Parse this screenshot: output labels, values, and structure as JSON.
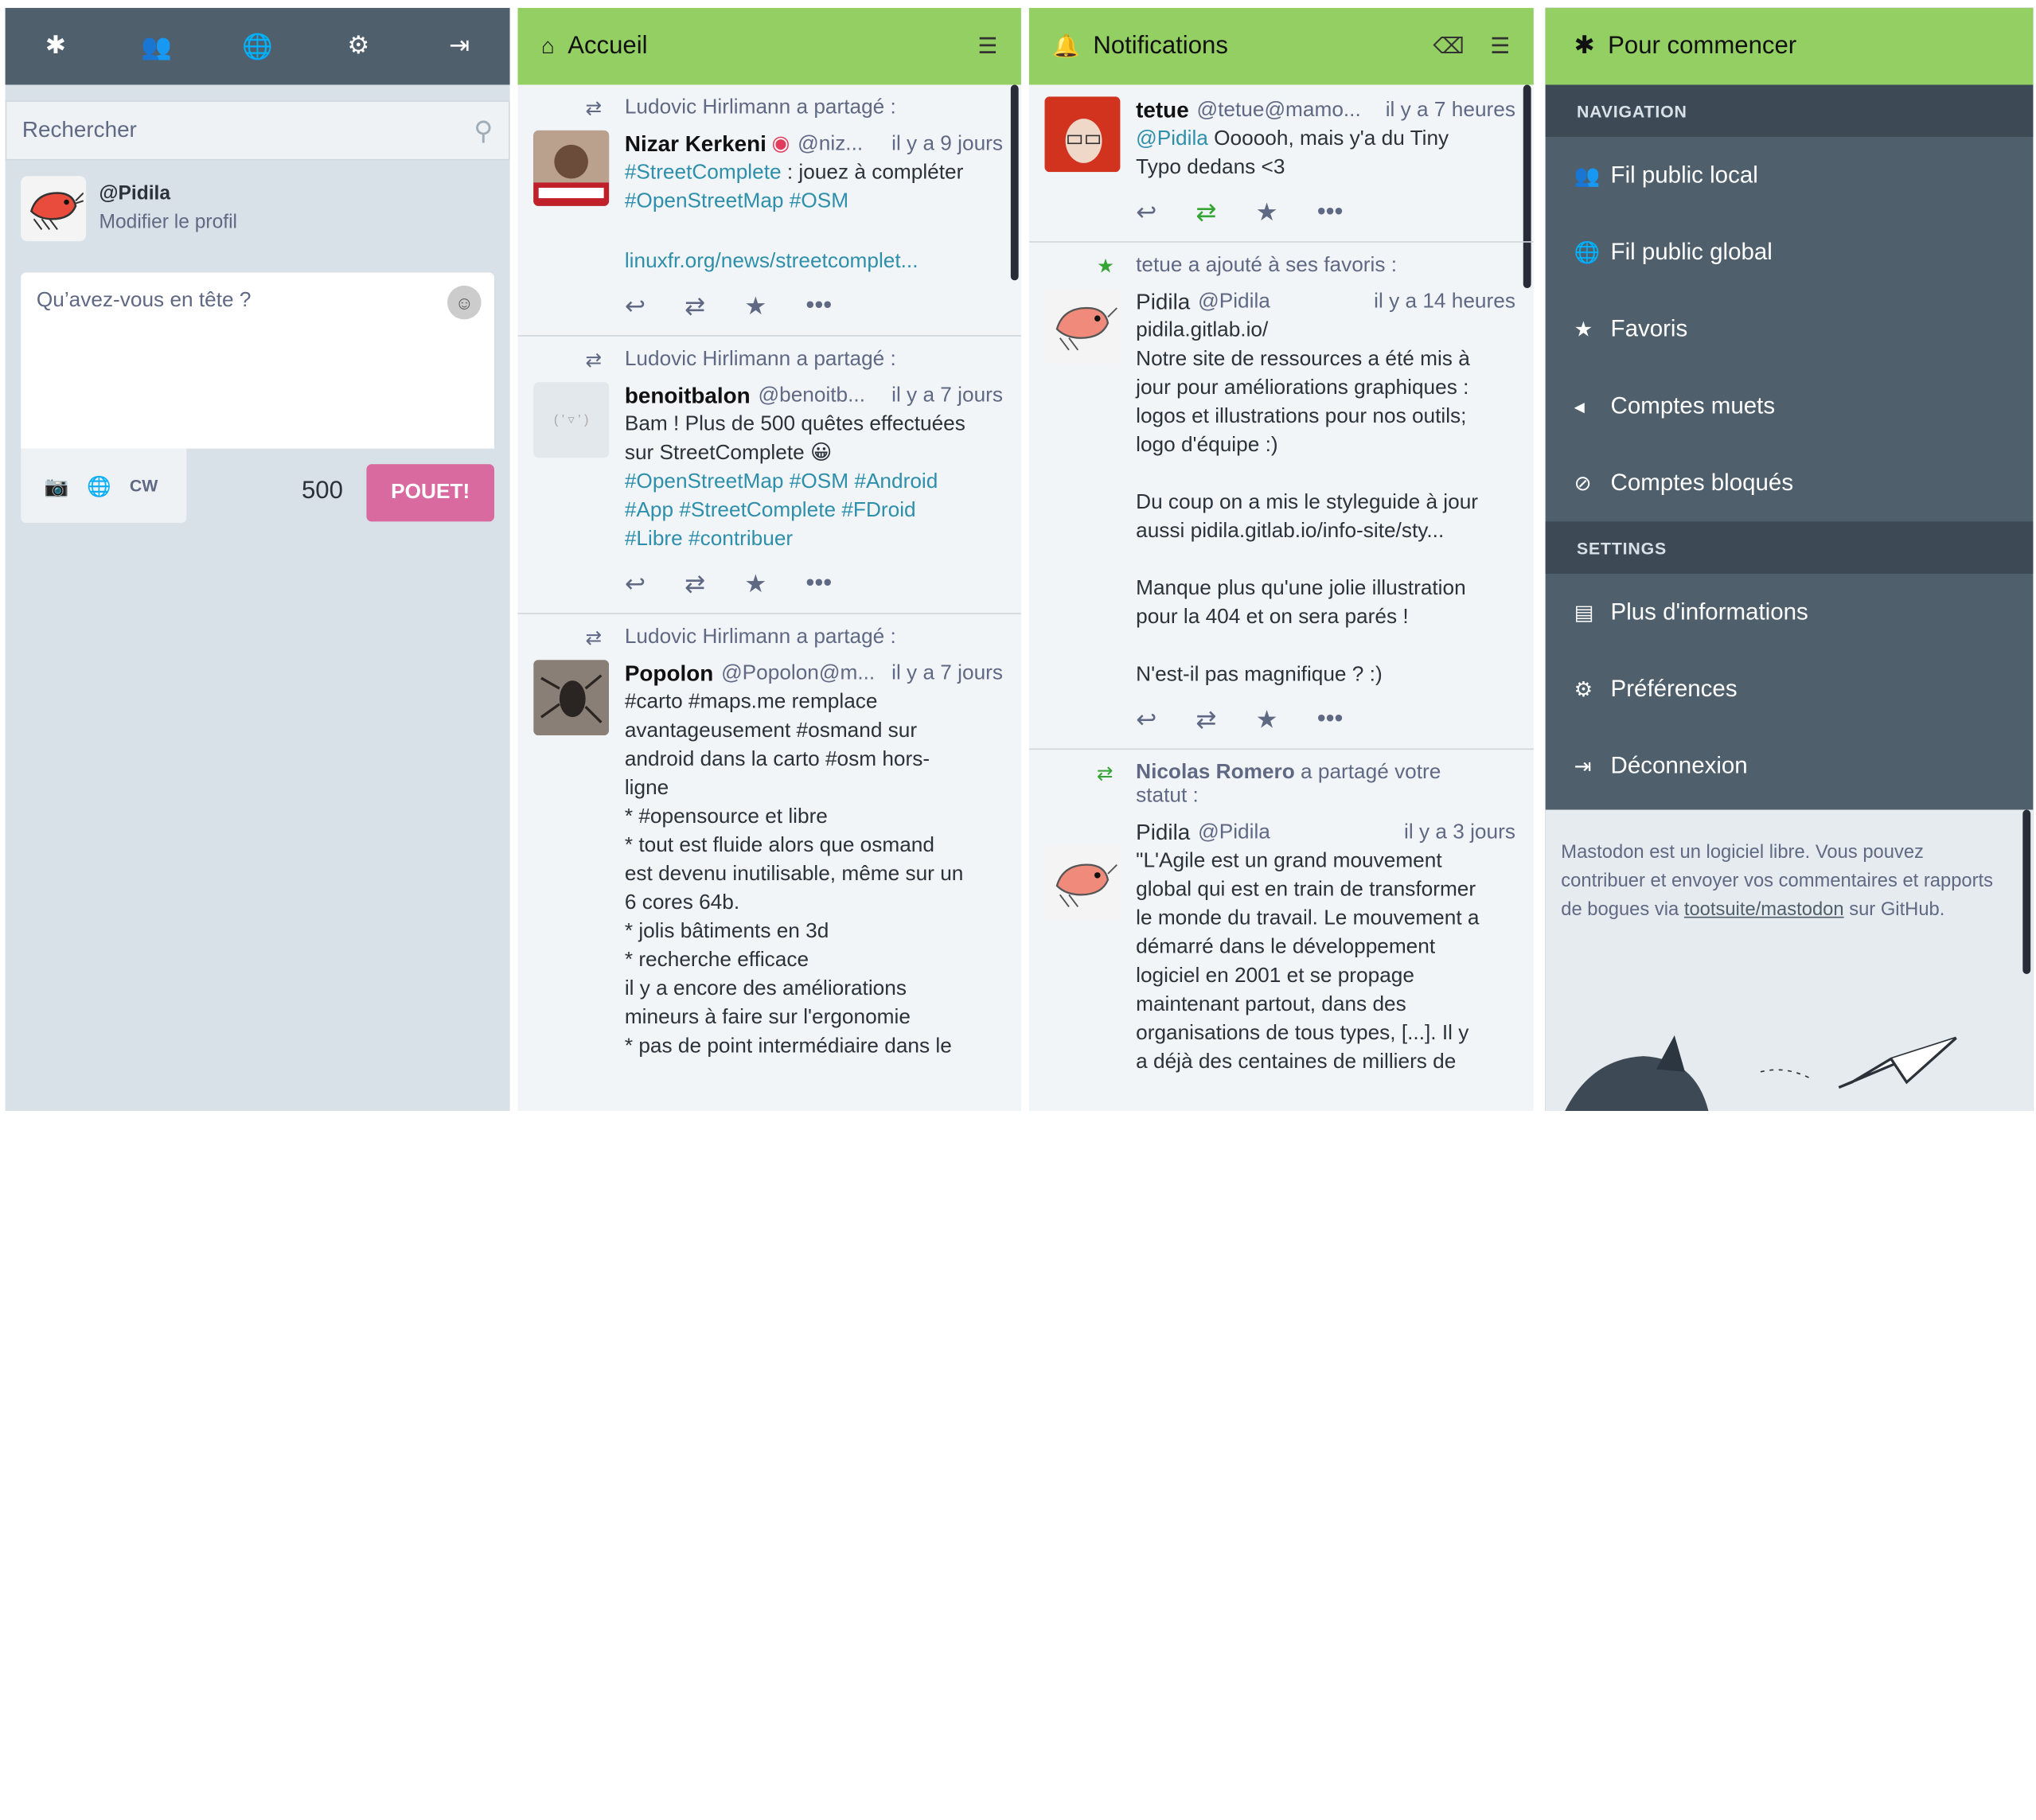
{
  "compose": {
    "search_placeholder": "Rechercher",
    "account_handle": "@Pidila",
    "edit_profile": "Modifier le profil",
    "textarea_placeholder": "Qu’avez-vous en tête ?",
    "cw_label": "CW",
    "char_count": "500",
    "toot_button": "POUET!"
  },
  "home": {
    "title": "Accueil",
    "statuses": [
      {
        "prepend": "Ludovic Hirlimann a partagé :",
        "name": "Nizar Kerkeni",
        "acct": "@niz...",
        "time": "il y a 9 jours",
        "lines": [
          "#StreetComplete : jouez à compléter",
          "#OpenStreetMap #OSM"
        ],
        "link": "linuxfr.org/news/streetcomplet..."
      },
      {
        "prepend": "Ludovic Hirlimann a partagé :",
        "name": "benoitbalon",
        "acct": "@benoitb...",
        "time": "il y a 7 jours",
        "lines": [
          "Bam ! Plus de 500 quêtes effectuées",
          "sur StreetComplete 😀",
          "#OpenStreetMap #OSM #Android",
          "#App #StreetComplete #FDroid",
          "#Libre #contribuer"
        ]
      },
      {
        "prepend": "Ludovic Hirlimann a partagé :",
        "name": "Popolon",
        "acct": "@Popolon@m...",
        "time": "il y a 7 jours",
        "lines": [
          "#carto #maps.me remplace",
          "avantageusement #osmand sur",
          "android dans la carto #osm hors-",
          "ligne",
          "* #opensource et libre",
          "* tout est fluide alors que osmand",
          "est devenu inutilisable, même sur un",
          "6 cores 64b.",
          "* jolis bâtiments en 3d",
          "* recherche efficace",
          "il y a encore des améliorations",
          "mineurs à faire sur l'ergonomie",
          "* pas de point intermédiaire dans le"
        ]
      }
    ]
  },
  "notifications": {
    "title": "Notifications",
    "items": [
      {
        "name": "tetue",
        "acct": "@tetue@mamo...",
        "time": "il y a 7 heures",
        "mention": "@Pidila",
        "text": " Oooooh, mais y'a du Tiny",
        "text2": "Typo dedans <3"
      },
      {
        "prepend": "tetue a ajouté à ses favoris :",
        "name": "Pidila",
        "acct": "@Pidila",
        "time": "il y a 14 heures",
        "paragraphs": [
          [
            "pidila.gitlab.io/",
            "Notre site de ressources a été mis à",
            "jour pour améliorations graphiques :",
            "logos et illustrations pour nos outils;",
            "logo d'équipe :)"
          ],
          [
            "Du coup on a mis le styleguide à jour",
            "aussi pidila.gitlab.io/info-site/sty..."
          ],
          [
            "Manque plus qu'une jolie illustration",
            "pour la 404 et on sera parés !"
          ],
          [
            "N'est-il pas magnifique ? :)"
          ]
        ]
      },
      {
        "prepend_name": "Nicolas Romero",
        "prepend_rest": " a partagé votre",
        "prepend_line2": "statut :",
        "name": "Pidila",
        "acct": "@Pidila",
        "time": "il y a 3 jours",
        "lines": [
          "\"L'Agile est un grand mouvement",
          "global qui est en train de transformer",
          "le monde du travail. Le mouvement a",
          "démarré dans le développement",
          "logiciel en 2001 et se propage",
          "maintenant partout, dans des",
          "organisations de tous types, [...]. Il y",
          "a déjà des centaines de milliers de"
        ]
      }
    ]
  },
  "getting_started": {
    "title": "Pour commencer",
    "nav_section": "NAVIGATION",
    "nav_items": [
      "Fil public local",
      "Fil public global",
      "Favoris",
      "Comptes muets",
      "Comptes bloqués"
    ],
    "settings_section": "SETTINGS",
    "settings_items": [
      "Plus d'informations",
      "Préférences",
      "Déconnexion"
    ],
    "footer_1": "Mastodon est un logiciel libre. Vous pouvez contribuer et envoyer vos commentaires et rapports de bogues via ",
    "footer_link": "tootsuite/mastodon",
    "footer_2": " sur GitHub."
  },
  "colors": {
    "header_green": "#93cf63",
    "drawer_dark": "#4f5f6b",
    "toot_button": "#d96aa0",
    "link": "#2e8fab"
  }
}
